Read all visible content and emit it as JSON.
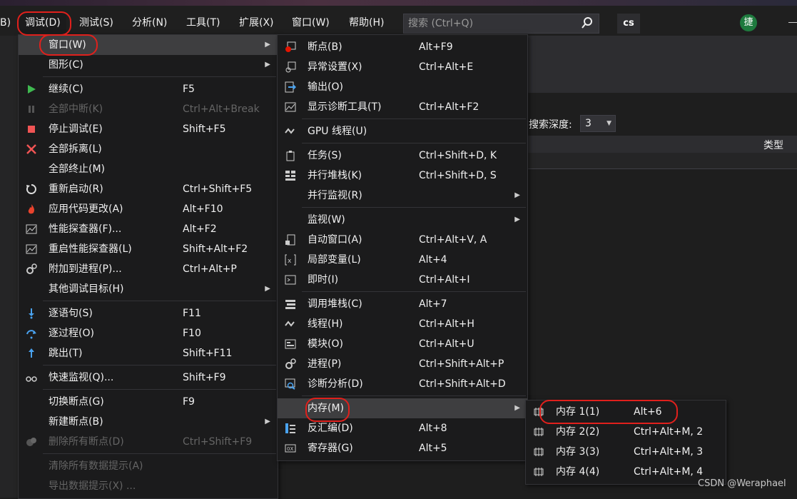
{
  "menubar": {
    "left_fragment": "B)",
    "items": [
      "调试(D)",
      "测试(S)",
      "分析(N)",
      "工具(T)",
      "扩展(X)",
      "窗口(W)",
      "帮助(H)"
    ],
    "search_placeholder": "搜索 (Ctrl+Q)",
    "solution_badge": "cs",
    "avatar_initial": "捷"
  },
  "background": {
    "search_depth_label": "搜索深度:",
    "search_depth_value": "3",
    "column_type": "类型"
  },
  "debug_menu": {
    "items": [
      {
        "label": "窗口(W)",
        "shortcut": "",
        "submenu": true,
        "highlight": true
      },
      {
        "label": "图形(C)",
        "shortcut": "",
        "submenu": true
      },
      {
        "label": "继续(C)",
        "shortcut": "F5",
        "icon": "play-icon"
      },
      {
        "label": "全部中断(K)",
        "shortcut": "Ctrl+Alt+Break",
        "disabled": true,
        "icon": "pause-icon"
      },
      {
        "label": "停止调试(E)",
        "shortcut": "Shift+F5",
        "icon": "stop-icon"
      },
      {
        "label": "全部拆离(L)",
        "shortcut": "",
        "icon": "close-icon"
      },
      {
        "label": "全部终止(M)",
        "shortcut": ""
      },
      {
        "label": "重新启动(R)",
        "shortcut": "Ctrl+Shift+F5",
        "icon": "restart-icon"
      },
      {
        "label": "应用代码更改(A)",
        "shortcut": "Alt+F10",
        "icon": "flame-icon"
      },
      {
        "label": "性能探查器(F)...",
        "shortcut": "Alt+F2",
        "icon": "profiler-icon"
      },
      {
        "label": "重启性能探查器(L)",
        "shortcut": "Shift+Alt+F2",
        "icon": "profiler-restart-icon"
      },
      {
        "label": "附加到进程(P)...",
        "shortcut": "Ctrl+Alt+P",
        "icon": "gears-icon"
      },
      {
        "label": "其他调试目标(H)",
        "shortcut": "",
        "submenu": true
      },
      {
        "label": "逐语句(S)",
        "shortcut": "F11",
        "icon": "step-into-icon"
      },
      {
        "label": "逐过程(O)",
        "shortcut": "F10",
        "icon": "step-over-icon"
      },
      {
        "label": "跳出(T)",
        "shortcut": "Shift+F11",
        "icon": "step-out-icon"
      },
      {
        "label": "快速监视(Q)...",
        "shortcut": "Shift+F9",
        "icon": "glasses-icon"
      },
      {
        "label": "切换断点(G)",
        "shortcut": "F9"
      },
      {
        "label": "新建断点(B)",
        "shortcut": "",
        "submenu": true
      },
      {
        "label": "删除所有断点(D)",
        "shortcut": "Ctrl+Shift+F9",
        "disabled": true,
        "icon": "delete-breakpoints-icon"
      },
      {
        "label": "清除所有数据提示(A)",
        "shortcut": "",
        "disabled": true
      },
      {
        "label": "导出数据提示(X) ...",
        "shortcut": "",
        "disabled": true
      }
    ]
  },
  "window_menu": {
    "items": [
      {
        "label": "断点(B)",
        "shortcut": "Alt+F9",
        "icon": "breakpoints-icon"
      },
      {
        "label": "异常设置(X)",
        "shortcut": "Ctrl+Alt+E",
        "icon": "exception-icon"
      },
      {
        "label": "输出(O)",
        "shortcut": "",
        "icon": "output-icon"
      },
      {
        "label": "显示诊断工具(T)",
        "shortcut": "Ctrl+Alt+F2",
        "icon": "diagnostic-icon"
      },
      {
        "label": "GPU 线程(U)",
        "shortcut": "",
        "icon": "gpu-threads-icon"
      },
      {
        "label": "任务(S)",
        "shortcut": "Ctrl+Shift+D, K",
        "icon": "tasks-icon"
      },
      {
        "label": "并行堆栈(K)",
        "shortcut": "Ctrl+Shift+D, S",
        "icon": "parallel-stacks-icon"
      },
      {
        "label": "并行监视(R)",
        "shortcut": "",
        "submenu": true
      },
      {
        "label": "监视(W)",
        "shortcut": "",
        "submenu": true
      },
      {
        "label": "自动窗口(A)",
        "shortcut": "Ctrl+Alt+V, A",
        "icon": "autos-icon"
      },
      {
        "label": "局部变量(L)",
        "shortcut": "Alt+4",
        "icon": "locals-icon"
      },
      {
        "label": "即时(I)",
        "shortcut": "Ctrl+Alt+I",
        "icon": "immediate-icon"
      },
      {
        "label": "调用堆栈(C)",
        "shortcut": "Alt+7",
        "icon": "call-stack-icon"
      },
      {
        "label": "线程(H)",
        "shortcut": "Ctrl+Alt+H",
        "icon": "threads-icon"
      },
      {
        "label": "模块(O)",
        "shortcut": "Ctrl+Alt+U",
        "icon": "modules-icon"
      },
      {
        "label": "进程(P)",
        "shortcut": "Ctrl+Shift+Alt+P",
        "icon": "processes-icon"
      },
      {
        "label": "诊断分析(D)",
        "shortcut": "Ctrl+Shift+Alt+D",
        "icon": "diagnostic-analysis-icon"
      },
      {
        "label": "内存(M)",
        "shortcut": "",
        "submenu": true,
        "highlight": true
      },
      {
        "label": "反汇编(D)",
        "shortcut": "Alt+8",
        "icon": "disassembly-icon"
      },
      {
        "label": "寄存器(G)",
        "shortcut": "Alt+5",
        "icon": "registers-icon"
      }
    ]
  },
  "memory_menu": {
    "items": [
      {
        "label": "内存 1(1)",
        "shortcut": "Alt+6"
      },
      {
        "label": "内存 2(2)",
        "shortcut": "Ctrl+Alt+M, 2"
      },
      {
        "label": "内存 3(3)",
        "shortcut": "Ctrl+Alt+M, 3"
      },
      {
        "label": "内存 4(4)",
        "shortcut": "Ctrl+Alt+M, 4"
      }
    ]
  },
  "watermark": "CSDN @Weraphael",
  "colors": {
    "accent_red": "#e0201c",
    "menu_bg": "#1b1b1c",
    "highlight": "#3e3e40"
  }
}
